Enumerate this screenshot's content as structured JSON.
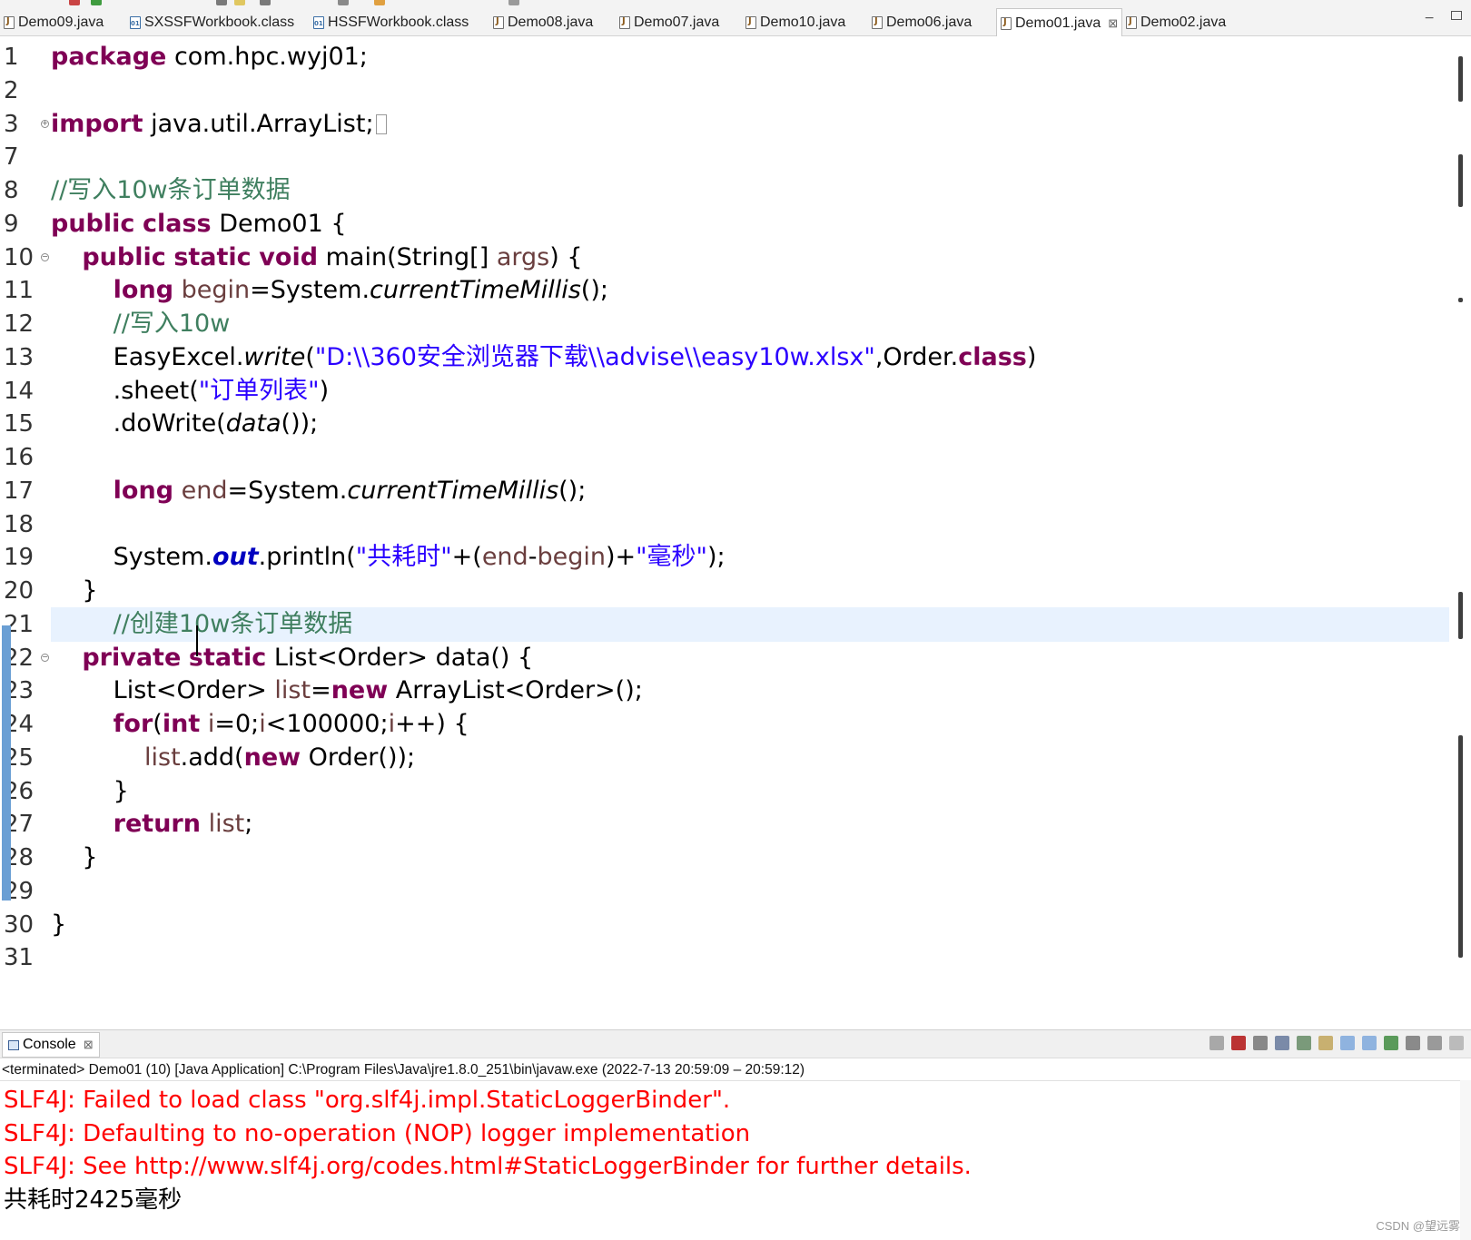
{
  "tabs": [
    {
      "label": "Demo09.java",
      "icon": "java-file-icon"
    },
    {
      "label": "SXSSFWorkbook.class",
      "icon": "class-file-icon"
    },
    {
      "label": "HSSFWorkbook.class",
      "icon": "class-file-icon"
    },
    {
      "label": "Demo08.java",
      "icon": "java-file-icon"
    },
    {
      "label": "Demo07.java",
      "icon": "java-file-icon"
    },
    {
      "label": "Demo10.java",
      "icon": "java-file-icon"
    },
    {
      "label": "Demo06.java",
      "icon": "java-file-icon"
    },
    {
      "label": "Demo01.java",
      "icon": "java-file-icon",
      "active": true,
      "close_glyph": "⊠"
    },
    {
      "label": "Demo02.java",
      "icon": "java-file-icon"
    }
  ],
  "window_controls": {
    "minimize": "−"
  },
  "editor": {
    "current_line": 21,
    "line_numbers": [
      "1",
      "2",
      "3",
      "7",
      "8",
      "9",
      "10",
      "11",
      "12",
      "13",
      "14",
      "15",
      "16",
      "17",
      "18",
      "19",
      "20",
      "21",
      "22",
      "23",
      "24",
      "25",
      "26",
      "27",
      "28",
      "29",
      "30",
      "31"
    ],
    "lines": [
      {
        "n": "1",
        "tokens": [
          {
            "t": "package",
            "c": "kw"
          },
          {
            "t": " com.hpc.wyj01;"
          }
        ]
      },
      {
        "n": "2",
        "tokens": []
      },
      {
        "n": "3",
        "tokens": [
          {
            "t": "import",
            "c": "kw"
          },
          {
            "t": " java.util.ArrayList;"
          }
        ]
      },
      {
        "n": "7",
        "tokens": []
      },
      {
        "n": "8",
        "tokens": [
          {
            "t": "//写入10w条订单数据",
            "c": "cm"
          }
        ]
      },
      {
        "n": "9",
        "tokens": [
          {
            "t": "public",
            "c": "kw"
          },
          {
            "t": " "
          },
          {
            "t": "class",
            "c": "kw"
          },
          {
            "t": " Demo01 {"
          }
        ]
      },
      {
        "n": "10",
        "tokens": [
          {
            "t": "    "
          },
          {
            "t": "public",
            "c": "kw"
          },
          {
            "t": " "
          },
          {
            "t": "static",
            "c": "kw"
          },
          {
            "t": " "
          },
          {
            "t": "void",
            "c": "kw"
          },
          {
            "t": " main(String[] "
          },
          {
            "t": "args",
            "c": "vr"
          },
          {
            "t": ") {"
          }
        ]
      },
      {
        "n": "11",
        "tokens": [
          {
            "t": "        "
          },
          {
            "t": "long",
            "c": "kw"
          },
          {
            "t": " "
          },
          {
            "t": "begin",
            "c": "vr"
          },
          {
            "t": "=System."
          },
          {
            "t": "currentTimeMillis",
            "c": "it"
          },
          {
            "t": "();"
          }
        ]
      },
      {
        "n": "12",
        "tokens": [
          {
            "t": "        "
          },
          {
            "t": "//写入10w",
            "c": "cm"
          }
        ]
      },
      {
        "n": "13",
        "tokens": [
          {
            "t": "        EasyExcel."
          },
          {
            "t": "write",
            "c": "it"
          },
          {
            "t": "("
          },
          {
            "t": "\"D:\\\\360安全浏览器下载\\\\advise\\\\easy10w.xlsx\"",
            "c": "str"
          },
          {
            "t": ",Order."
          },
          {
            "t": "class",
            "c": "kw"
          },
          {
            "t": ")"
          }
        ]
      },
      {
        "n": "14",
        "tokens": [
          {
            "t": "        .sheet("
          },
          {
            "t": "\"订单列表\"",
            "c": "str"
          },
          {
            "t": ")"
          }
        ]
      },
      {
        "n": "15",
        "tokens": [
          {
            "t": "        .doWrite("
          },
          {
            "t": "data",
            "c": "it"
          },
          {
            "t": "());"
          }
        ]
      },
      {
        "n": "16",
        "tokens": []
      },
      {
        "n": "17",
        "tokens": [
          {
            "t": "        "
          },
          {
            "t": "long",
            "c": "kw"
          },
          {
            "t": " "
          },
          {
            "t": "end",
            "c": "vr"
          },
          {
            "t": "=System."
          },
          {
            "t": "currentTimeMillis",
            "c": "it"
          },
          {
            "t": "();"
          }
        ]
      },
      {
        "n": "18",
        "tokens": []
      },
      {
        "n": "19",
        "tokens": [
          {
            "t": "        System."
          },
          {
            "t": "out",
            "c": "fld"
          },
          {
            "t": ".println("
          },
          {
            "t": "\"共耗时\"",
            "c": "str"
          },
          {
            "t": "+("
          },
          {
            "t": "end",
            "c": "vr"
          },
          {
            "t": "-"
          },
          {
            "t": "begin",
            "c": "vr"
          },
          {
            "t": ")+"
          },
          {
            "t": "\"毫秒\"",
            "c": "str"
          },
          {
            "t": ");"
          }
        ]
      },
      {
        "n": "20",
        "tokens": [
          {
            "t": "    }"
          }
        ]
      },
      {
        "n": "21",
        "tokens": [
          {
            "t": "        "
          },
          {
            "t": "//创建10w条订单数据",
            "c": "cm"
          }
        ]
      },
      {
        "n": "22",
        "tokens": [
          {
            "t": "    "
          },
          {
            "t": "private",
            "c": "kw"
          },
          {
            "t": " "
          },
          {
            "t": "static",
            "c": "kw"
          },
          {
            "t": " List<Order> data() {"
          }
        ]
      },
      {
        "n": "23",
        "tokens": [
          {
            "t": "        List<Order> "
          },
          {
            "t": "list",
            "c": "vr"
          },
          {
            "t": "="
          },
          {
            "t": "new",
            "c": "kw"
          },
          {
            "t": " ArrayList<Order>();"
          }
        ]
      },
      {
        "n": "24",
        "tokens": [
          {
            "t": "        "
          },
          {
            "t": "for",
            "c": "kw"
          },
          {
            "t": "("
          },
          {
            "t": "int",
            "c": "kw"
          },
          {
            "t": " "
          },
          {
            "t": "i",
            "c": "vr"
          },
          {
            "t": "=0;"
          },
          {
            "t": "i",
            "c": "vr"
          },
          {
            "t": "<100000;"
          },
          {
            "t": "i",
            "c": "vr"
          },
          {
            "t": "++) {"
          }
        ]
      },
      {
        "n": "25",
        "tokens": [
          {
            "t": "            "
          },
          {
            "t": "list",
            "c": "vr"
          },
          {
            "t": ".add("
          },
          {
            "t": "new",
            "c": "kw"
          },
          {
            "t": " Order());"
          }
        ]
      },
      {
        "n": "26",
        "tokens": [
          {
            "t": "        }"
          }
        ]
      },
      {
        "n": "27",
        "tokens": [
          {
            "t": "        "
          },
          {
            "t": "return",
            "c": "kw"
          },
          {
            "t": " "
          },
          {
            "t": "list",
            "c": "vr"
          },
          {
            "t": ";"
          }
        ]
      },
      {
        "n": "28",
        "tokens": [
          {
            "t": "    }"
          }
        ]
      },
      {
        "n": "29",
        "tokens": []
      },
      {
        "n": "30",
        "tokens": [
          {
            "t": "}"
          }
        ]
      },
      {
        "n": "31",
        "tokens": []
      }
    ],
    "folded_lines": [
      "3",
      "10",
      "22"
    ],
    "fold_glyphs": {
      "3": "+",
      "10": "−",
      "22": "−"
    }
  },
  "console": {
    "tab_label": "Console",
    "tab_close_glyph": "⊠",
    "status": "<terminated> Demo01 (10) [Java Application] C:\\Program Files\\Java\\jre1.8.0_251\\bin\\javaw.exe  (2022-7-13 20:59:09 – 20:59:12)",
    "output": [
      {
        "text": "SLF4J: Failed to load class \"org.slf4j.impl.StaticLoggerBinder\".",
        "kind": "err"
      },
      {
        "text": "SLF4J: Defaulting to no-operation (NOP) logger implementation",
        "kind": "err"
      },
      {
        "text": "SLF4J: See http://www.slf4j.org/codes.html#StaticLoggerBinder for further details.",
        "kind": "err"
      },
      {
        "text": "共耗时2425毫秒",
        "kind": "norm"
      }
    ]
  },
  "watermark": "CSDN @望远雾",
  "colors": {
    "keyword": "#7f0055",
    "string": "#2a00ff",
    "comment": "#3f7f5f",
    "variable": "#6a3e3e",
    "static_field": "#0000c0",
    "error_text": "#ff0000",
    "current_line_bg": "#e8f2fe",
    "change_bar": "#6a9fd4"
  }
}
